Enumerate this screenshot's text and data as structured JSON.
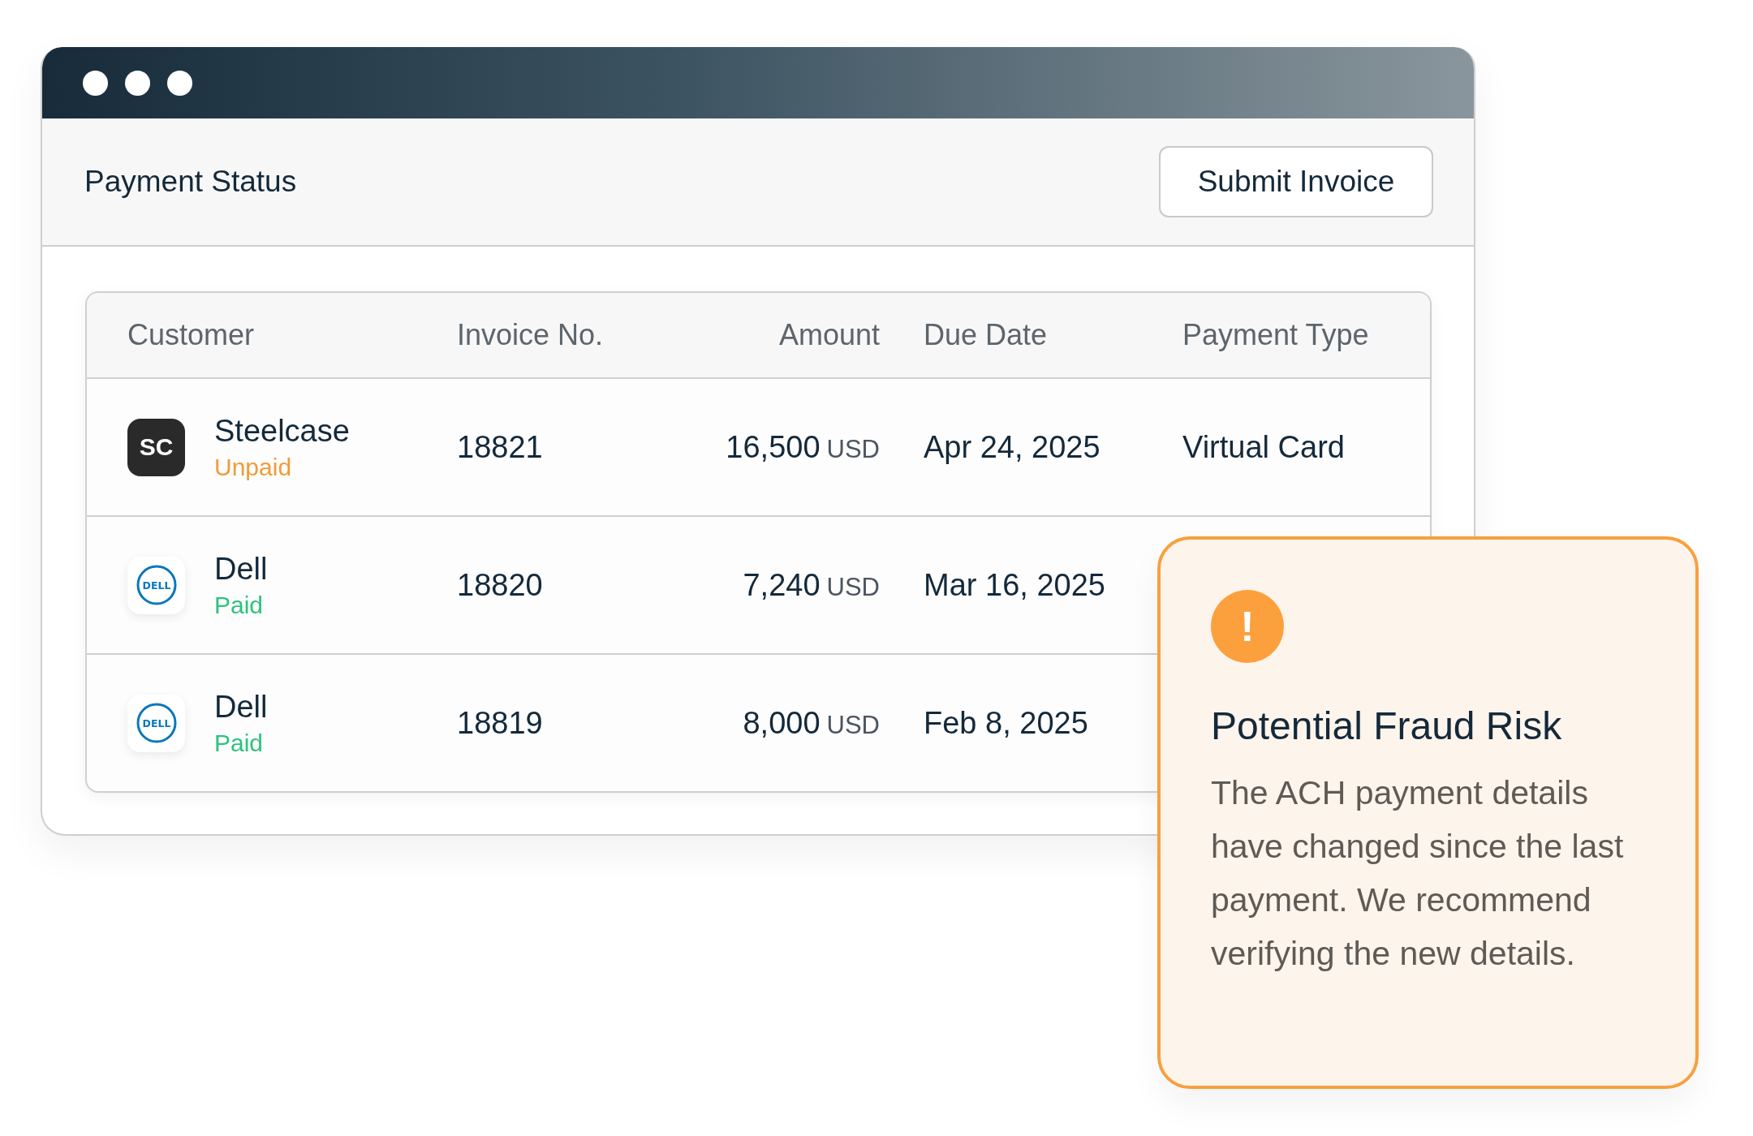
{
  "window": {
    "title": "Payment Status",
    "button": "Submit Invoice"
  },
  "table": {
    "columns": [
      "Customer",
      "Invoice No.",
      "Amount",
      "Due Date",
      "Payment Type"
    ],
    "rows": [
      {
        "logo": {
          "kind": "monogram",
          "text": "SC"
        },
        "customer": "Steelcase",
        "status": {
          "label": "Unpaid",
          "kind": "unpaid"
        },
        "invoice": "18821",
        "amount": "16,500",
        "currency": "USD",
        "due": "Apr 24, 2025",
        "payment_type": "Virtual Card"
      },
      {
        "logo": {
          "kind": "circle",
          "text": "DELL"
        },
        "customer": "Dell",
        "status": {
          "label": "Paid",
          "kind": "paid"
        },
        "invoice": "18820",
        "amount": "7,240",
        "currency": "USD",
        "due": "Mar 16, 2025"
      },
      {
        "logo": {
          "kind": "circle",
          "text": "DELL"
        },
        "customer": "Dell",
        "status": {
          "label": "Paid",
          "kind": "paid"
        },
        "invoice": "18819",
        "amount": "8,000",
        "currency": "USD",
        "due": "Feb 8, 2025"
      }
    ]
  },
  "alert": {
    "icon_text": "!",
    "title": "Potential Fraud Risk",
    "body": "The ACH payment details have changed since the last payment. We recommend verifying the new details."
  }
}
